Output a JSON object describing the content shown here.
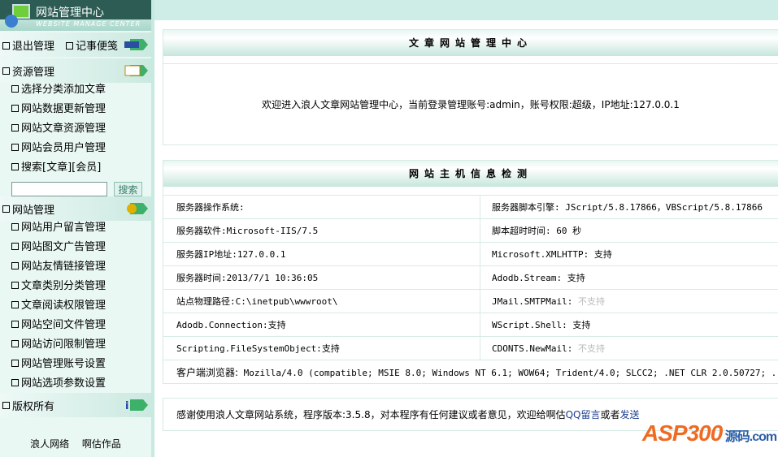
{
  "sidebar": {
    "title": "网站管理中心",
    "subtitle": "WEBSITE MANAGE CENTER",
    "logout": "退出管理",
    "notes": "记事便笺",
    "res_section": "资源管理",
    "res_items": [
      "选择分类添加文章",
      "网站数据更新管理",
      "网站文章资源管理",
      "网站会员用户管理",
      "搜索[文章][会员]"
    ],
    "search_value": "",
    "search_btn": "搜索",
    "site_section": "网站管理",
    "site_items": [
      "网站用户留言管理",
      "网站图文广告管理",
      "网站友情链接管理",
      "文章类别分类管理",
      "文章阅读权限管理",
      "网站空间文件管理",
      "网站访问限制管理",
      "网站管理账号设置",
      "网站选项参数设置"
    ],
    "copy_section": "版权所有",
    "credit": "浪人网络　 啊估作品"
  },
  "welcome": {
    "title": "文章网站管理中心",
    "text": "欢迎进入浪人文章网站管理中心，当前登录管理账号:admin，账号权限:超级，IP地址:127.0.0.1"
  },
  "info": {
    "title": "网站主机信息检测",
    "rows": [
      [
        {
          "label": "服务器操作系统:",
          "value": ""
        },
        {
          "label": "服务器脚本引擎:",
          "value": "JScript/5.8.17866，VBScript/5.8.17866"
        }
      ],
      [
        {
          "label": "服务器软件:",
          "value": "Microsoft-IIS/7.5"
        },
        {
          "label": "脚本超时时间:",
          "value": "60 秒"
        }
      ],
      [
        {
          "label": "服务器IP地址:",
          "value": "127.0.0.1"
        },
        {
          "label": "Microsoft.XMLHTTP:",
          "value": "支持"
        }
      ],
      [
        {
          "label": "服务器时间:",
          "value": "2013/7/1 10:36:05"
        },
        {
          "label": "Adodb.Stream:",
          "value": "支持"
        }
      ],
      [
        {
          "label": "站点物理路径:",
          "value": "C:\\inetpub\\wwwroot\\"
        },
        {
          "label": "JMail.SMTPMail:",
          "value": "不支持"
        }
      ],
      [
        {
          "label": "Adodb.Connection:",
          "value": "支持"
        },
        {
          "label": "WScript.Shell:",
          "value": "支持"
        }
      ],
      [
        {
          "label": "Scripting.FileSystemObject:",
          "value": "支持"
        },
        {
          "label": "CDONTS.NewMail:",
          "value": "不支持"
        }
      ]
    ],
    "browser_label": "客户端浏览器:",
    "browser_value": "Mozilla/4.0 (compatible; MSIE 8.0; Windows NT 6.1; WOW64; Trident/4.0; SLCC2; .NET CLR 2.0.50727; ..."
  },
  "footer": {
    "text": "感谢使用浪人文章网站系统，程序版本:3.5.8，对本程序有任何建议或者意见，欢迎给啊估",
    "link1": "QQ留言",
    "mid": "或者",
    "link2": "发送"
  },
  "watermark": {
    "logo": "ASP300",
    "suffix": "源码.com"
  }
}
